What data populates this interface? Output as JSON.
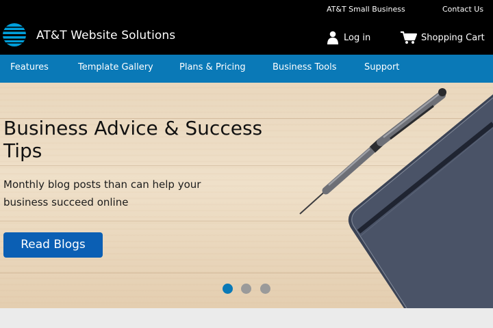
{
  "header": {
    "util_links": [
      "AT&T Small Business",
      "Contact Us"
    ],
    "brand": "AT&T Website Solutions",
    "login_label": "Log in",
    "cart_label": "Shopping Cart"
  },
  "nav": {
    "items": [
      "Features",
      "Template Gallery",
      "Plans & Pricing",
      "Business Tools",
      "Support"
    ]
  },
  "hero": {
    "title": "Business Advice & Success Tips",
    "subtitle": "Monthly blog posts than can help your business succeed online",
    "button_label": "Read Blogs",
    "slides": 3,
    "active_slide": 1
  },
  "icons": [
    "att-globe-icon",
    "user-icon",
    "shopping-cart-icon",
    "pen-icon",
    "notebook-icon"
  ],
  "colors": {
    "header_bg": "#000000",
    "nav_bg": "#0a79b7",
    "button_bg": "#0b5fb4",
    "dot_active": "#0a79b7",
    "dot_inactive": "#9a9a9a",
    "globe": "#009fdb"
  }
}
